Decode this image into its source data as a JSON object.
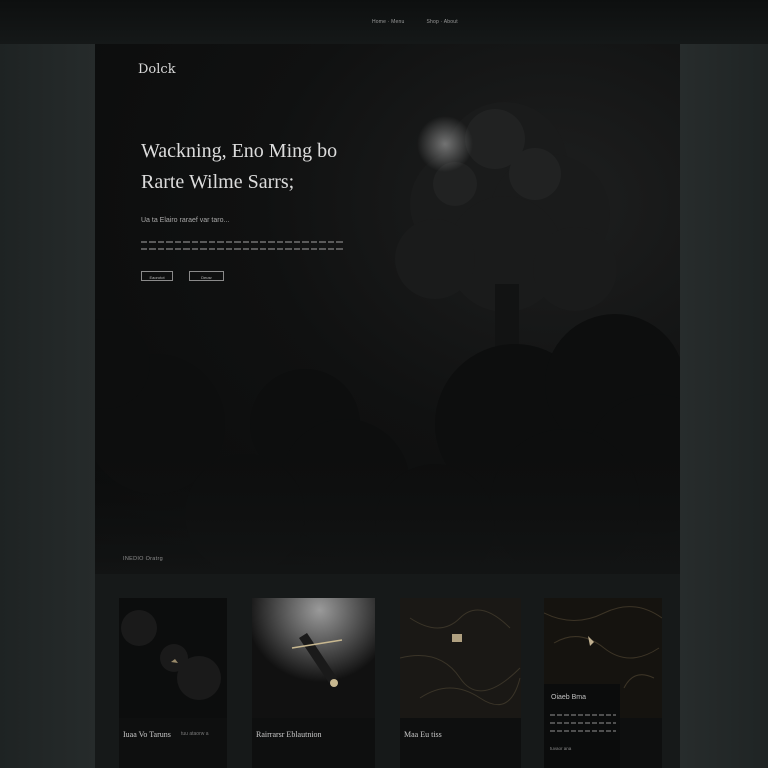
{
  "nav": {
    "items": [
      "Home  ·  Menu",
      "Shop  ·  About"
    ]
  },
  "hero": {
    "brand": "Dolck",
    "headline_line1": "Wackning, Eno Ming bo",
    "headline_line2": "Rarte Wilme Sarrs;",
    "subhead": "Ua ta Elairo raraef var taro...",
    "primary_button": "Eaorotot",
    "secondary_button": "Deusr",
    "footer_label": "INEDIO  Oratrg"
  },
  "cards": [
    {
      "title": "Iuaa Vo Taruns",
      "meta": "tuu ataorw a"
    },
    {
      "title": "Rairrarsr Eblautnion",
      "meta": ""
    },
    {
      "title": "Maa Eu tiss",
      "meta": ""
    },
    {
      "title": "Oiaeb Bma",
      "meta": "tuvaor  ana"
    }
  ],
  "colors": {
    "background": "#1c2020",
    "hero": "#0a0b0b",
    "text": "#dcdcdc",
    "muted": "#8e8e8e"
  }
}
